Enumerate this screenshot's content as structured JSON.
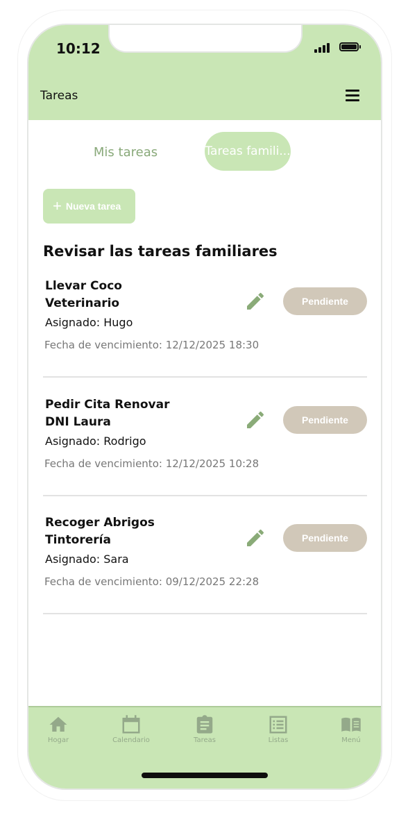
{
  "status_bar": {
    "time": "10:12"
  },
  "header": {
    "title": "Tareas",
    "menu_icon": "hamburger-icon"
  },
  "tabs": [
    {
      "label": "Mis tareas",
      "selected": false
    },
    {
      "label": "Tareas famili...",
      "selected": true
    }
  ],
  "new_task_button": {
    "icon": "plus-icon",
    "label": "Nueva tarea"
  },
  "section_title": "Revisar las tareas familiares",
  "tasks": [
    {
      "title": "Llevar Coco Veterinario",
      "assigned": "Asignado: Hugo",
      "due": "Fecha de vencimiento: 12/12/2025 18:30",
      "status": "Pendiente"
    },
    {
      "title": "Pedir Cita Renovar DNI Laura",
      "assigned": "Asignado: Rodrigo",
      "due": "Fecha de vencimiento: 12/12/2025 10:28",
      "status": "Pendiente"
    },
    {
      "title": "Recoger Abrigos Tintorería",
      "assigned": "Asignado: Sara",
      "due": "Fecha de vencimiento: 09/12/2025 22:28",
      "status": "Pendiente"
    }
  ],
  "bottom_nav": [
    {
      "label": "Hogar",
      "icon": "home-icon"
    },
    {
      "label": "Calendario",
      "icon": "calendar-icon"
    },
    {
      "label": "Tareas",
      "icon": "clipboard-icon"
    },
    {
      "label": "Listas",
      "icon": "list-icon"
    },
    {
      "label": "Menú",
      "icon": "book-icon"
    }
  ],
  "colors": {
    "accent": "#c9e6b5",
    "tab_text": "#89a97a",
    "edit_icon": "#8aab78",
    "status": "#d1c8b9",
    "nav_icon": "#94a98a"
  }
}
